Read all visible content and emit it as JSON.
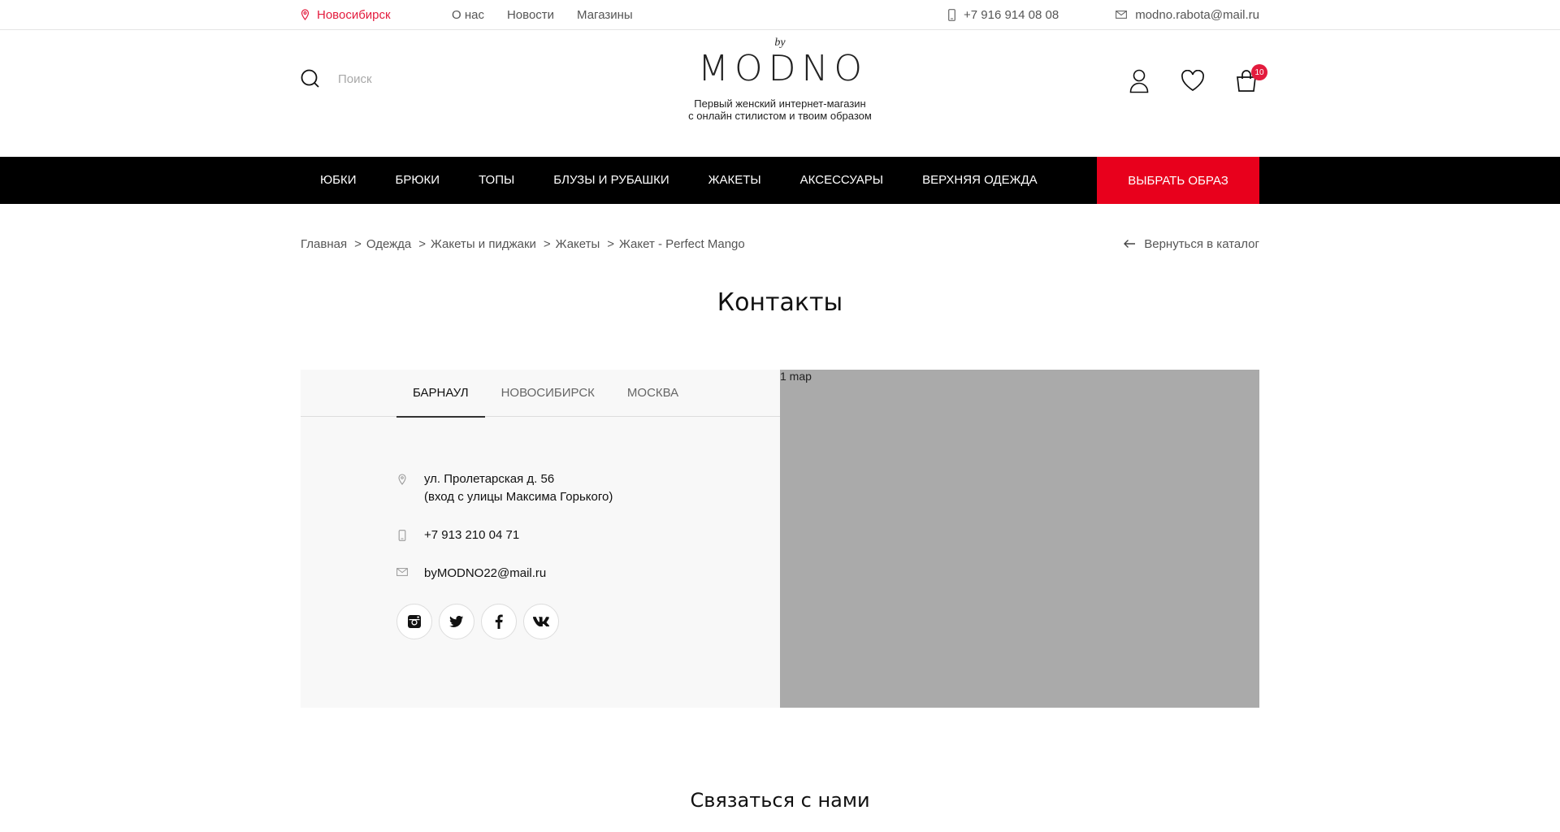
{
  "topbar": {
    "city": "Новосибирск",
    "nav": [
      "О нас",
      "Новости",
      "Магазины"
    ],
    "phone": "+7 916 914 08 08",
    "email": "modno.rabota@mail.ru"
  },
  "header": {
    "search_placeholder": "Поиск",
    "logo_by": "by",
    "logo_brand": "MODNO",
    "tagline_line1": "Первый женский интернет-магазин",
    "tagline_line2": "с онлайн стилистом и твоим образом",
    "cart_count": "10"
  },
  "nav": {
    "items": [
      "Юбки",
      "Брюки",
      "Топы",
      "Блузы и рубашки",
      "Жакеты",
      "Аксессуары",
      "Верхняя одежда"
    ],
    "cta": "Выбрать образ"
  },
  "breadcrumbs": {
    "items": [
      "Главная",
      "Одежда",
      "Жакеты и пиджаки",
      "Жакеты",
      "Жакет - Perfect Mango"
    ],
    "separator": ">",
    "back": "Вернуться в каталог"
  },
  "page": {
    "title": "Контакты",
    "subtitle": "Связаться с нами"
  },
  "contacts": {
    "tabs": [
      "Барнаул",
      "Новосибирск",
      "Москва"
    ],
    "active_tab": 0,
    "address_line1": "ул. Пролетарская д. 56",
    "address_line2": "(вход с улицы Максима Горького)",
    "phone": "+7 913 210 04 71",
    "email": "byMODNO22@mail.ru",
    "socials": [
      "instagram-icon",
      "twitter-icon",
      "facebook-icon",
      "vk-icon"
    ]
  },
  "map": {
    "label": "1 map"
  },
  "colors": {
    "accent": "#e8001c",
    "nav_bg": "#000000",
    "panel_bg": "#f8f8f8",
    "map_bg": "#aaaaaa"
  }
}
